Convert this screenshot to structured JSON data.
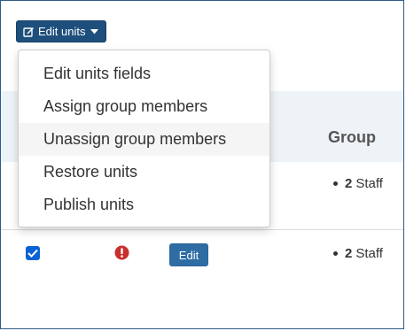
{
  "toolbar": {
    "edit_units_label": "Edit units",
    "edit_icon": "pencil-square-icon",
    "caret_icon": "caret-down-icon"
  },
  "dropdown": {
    "items": [
      {
        "label": "Edit units fields"
      },
      {
        "label": "Assign group members"
      },
      {
        "label": "Unassign group members",
        "highlighted": true
      },
      {
        "label": "Restore units"
      },
      {
        "label": "Publish units"
      }
    ]
  },
  "table": {
    "columns": {
      "group": "Group"
    },
    "rows": [
      {
        "group_count": "2",
        "group_name": "Staff"
      },
      {
        "checked": true,
        "warning_icon": "exclamation-circle-icon",
        "edit_label": "Edit",
        "group_count": "2",
        "group_name": "Staff"
      }
    ]
  },
  "colors": {
    "primary_dark": "#1e4f7c",
    "primary": "#2e6da4",
    "checkbox": "#0a63d6",
    "warning": "#c9302c",
    "header_bg": "#eef3f8"
  }
}
